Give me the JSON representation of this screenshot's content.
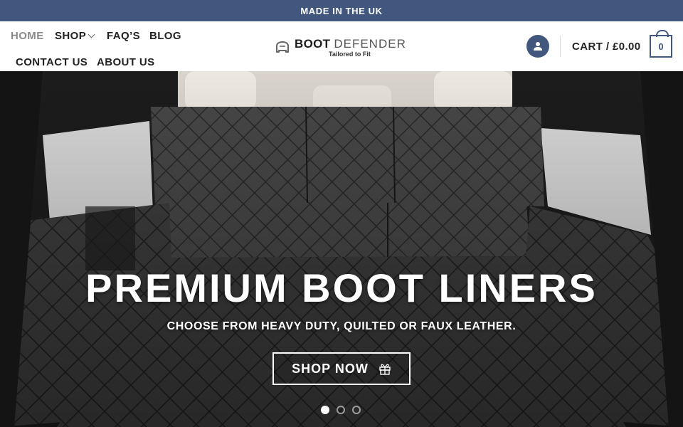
{
  "topbar": {
    "text": "MADE IN THE UK"
  },
  "nav": {
    "home": "HOME",
    "shop": "SHOP",
    "faqs": "FAQ’S",
    "blog": "BLOG",
    "contact": "CONTACT US",
    "about": "ABOUT US"
  },
  "logo": {
    "name_bold": "BOOT",
    "name_light": "DEFENDER",
    "tagline": "Tailored to Fit"
  },
  "account": {
    "icon": "user-icon"
  },
  "cart": {
    "label": "CART / £0.00",
    "count": "0"
  },
  "hero": {
    "title": "PREMIUM BOOT LINERS",
    "subtitle": "CHOOSE FROM HEAVY DUTY, QUILTED OR FAUX LEATHER.",
    "cta": "SHOP NOW",
    "cta_icon": "gift-icon",
    "active_slide": 1,
    "slide_count": 3
  },
  "colors": {
    "brand": "#42577d",
    "text": "#222222"
  }
}
